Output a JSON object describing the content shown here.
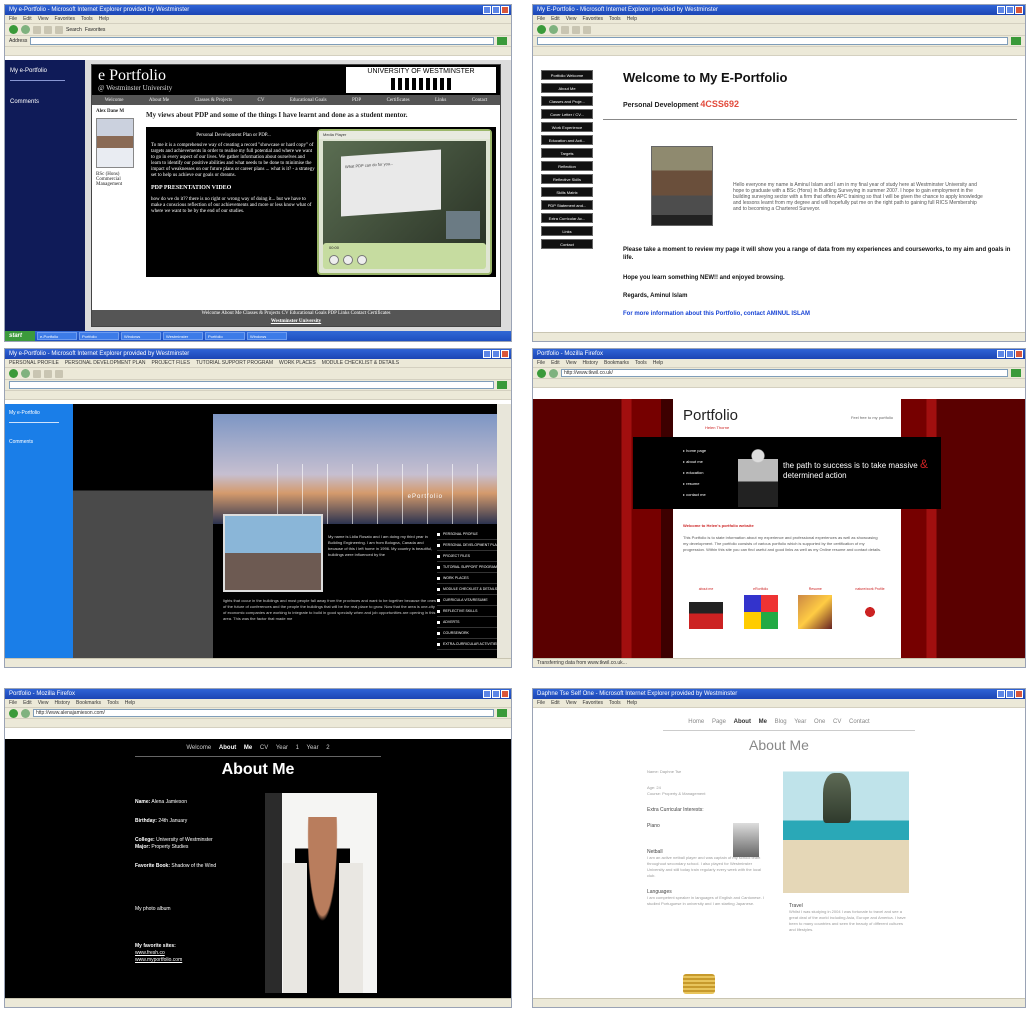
{
  "shot1": {
    "window_title": "My e-Portfolio - Microsoft Internet Explorer provided by Westminster",
    "menu": [
      "File",
      "Edit",
      "View",
      "Favorites",
      "Tools",
      "Help"
    ],
    "toolbar": {
      "back": "Back",
      "search": "Search",
      "favorites": "Favorites"
    },
    "address_label": "Address",
    "sidebar": {
      "item1": "My e-Portfolio",
      "item2": "Comments"
    },
    "banner": {
      "title": "e Portfolio",
      "subtitle": "@ Westminster University",
      "university": "UNIVERSITY OF WESTMINSTER"
    },
    "topnav": [
      "Welcome",
      "About Me",
      "Classes & Projects",
      "CV",
      "Educational Goals",
      "PDP",
      "Certificates",
      "Links",
      "Contact"
    ],
    "profile": {
      "name": "Alex Dane M",
      "course1": "BSc (Hons)",
      "course2": "Commercial",
      "course3": "Management"
    },
    "headline": "My views about PDP and some of the things I have learnt and done as a student mentor.",
    "dark": {
      "heading": "Personal Development Plan or PDP...",
      "body": "To me it is a comprehensive way of creating a record \"showcase or hard copy\" of targets and achievements in order to realise my full potential and where we want to go in every aspect of our lives. We gather information about ourselves and learn to identify our positive abilities and what needs to be done to minimise the impact of weaknesses on our future plans or career plans ... what is it? - a strategy set to help us achieve our goals or dreams.",
      "link": "PDP PRESENTATION VIDEO",
      "body2": "how do we do it?? there is no right or wrong way of doing it... but we have to make a conscious reflection of our achievements and more or less know what of where we want to be by the end of our studies."
    },
    "player": {
      "menu": "Media Player",
      "slide": "What PDP can do for you...",
      "time": "00:00"
    },
    "footer": {
      "links": "Welcome About Me Classes & Projects CV Educational Goals PDP Links Contact Certificates",
      "uni": "Westminster University"
    },
    "taskbar": {
      "start": "start",
      "tasks": [
        "e-Portfolio",
        "Portfolio",
        "Windows",
        "Westminster",
        "Portfolio",
        "Windows"
      ]
    }
  },
  "shot2": {
    "window_title": "My E-Portfolio - Microsoft Internet Explorer provided by Westminster",
    "menu": [
      "File",
      "Edit",
      "View",
      "Favorites",
      "Tools",
      "Help"
    ],
    "nav": [
      "Portfolio Welcome",
      "About Me",
      "Classes and Proje...",
      "Cover Letter / CV...",
      "Work Experience",
      "Education and Acti...",
      "Targets",
      "Reflection",
      "Reflective Skills",
      "Skills Matrix",
      "PDP Statement and...",
      "Extra Curricular Ac...",
      "Links",
      "Contact"
    ],
    "welcome": "Welcome to My E-Portfolio",
    "pd_label": "Personal Development",
    "pd_code": "4CSS692",
    "intro": "Hello everyone my name is Aminul Islam and I am in my final year of study here at Westminster University and hope to graduate with a BSc (Hons) in Building Surveying in summer 2007. I hope to gain employment in the building surveying sector with a firm that offers APC training so that I will be given the chance to apply knowledge and lessons learnt from my degree and will hopefully put me on the right path to gaining full RICS Membership and to becoming a Chartered Surveyor.",
    "para1": "Please take a moment to review my page it will show you a range of data from my experiences and courseworks, to my aim and goals in life.",
    "para2": "Hope you learn something NEW!! and enjoyed browsing.",
    "para3": "Regards, Aminul Islam",
    "para4": "For more information about this Portfolio, contact AMINUL ISLAM"
  },
  "shot3": {
    "window_title": "My e-Portfolio - Microsoft Internet Explorer provided by Westminster",
    "menu": [
      "PERSONAL PROFILE",
      "PERSONAL DEVELOPMENT PLAN",
      "PROJECT FILES",
      "TUTORIAL SUPPORT PROGRAM",
      "WORK PLACES",
      "MODULE CHECKLIST & DETAILS",
      "CURRICULA VITA/RESUME",
      "REFLECTIVE SKILLS",
      "ADVERTS",
      "COURSEWORK",
      "EXTRA-CURRICULAR ACTIVITIES"
    ],
    "sidebar": {
      "item1": "My e-Portfolio",
      "item2": "Comments"
    },
    "site_title": "ePortfolio",
    "bio": "My name is Lidia Rosato and I am doing my third year in Building Engineering. I am from Bologna, Canada and because of this I left home in 1996. My country is beautiful, buildings were influenced by the",
    "bio2": "lights that occur in the buildings and most people fall away from the provinces and want to be together because the ones of the future of conferences and the people the buildings that will be the real place to grow. Now that the area is one-city of economic companies are working to integrate to build in good specially when and job opportunities are opening in this area. This was the factor that made me"
  },
  "shot4": {
    "window_title": "Portfolio - Mozilla Firefox",
    "menu": [
      "File",
      "Edit",
      "View",
      "History",
      "Bookmarks",
      "Tools",
      "Help"
    ],
    "address": "http://www.tkwil.co.uk/",
    "page_title": "Portfolio",
    "tagline": "Helen Thorne",
    "greeting": "Feel free to my portfolio",
    "nav": [
      "home page",
      "about me",
      "education",
      "resume",
      "contact me"
    ],
    "slogan1": "the path to success is to take",
    "slogan2": "massive",
    "slogan_amp": "&",
    "slogan3": "determined action",
    "intro_heading": "Welcome to Helen's portfolio website",
    "intro_text": "This Portfolio is to state information about my experience and professional experiences as well as showcasing my development. The portfolio consists of various portfolio which is supported by the certification of my progression. Within this site you can find useful and good links as well as my Online resume and contact details.",
    "cards": [
      "about me",
      "eRortfolio",
      "Resume",
      "nature/work Profile"
    ],
    "status": "Transferring data from www.tkwil.co.uk..."
  },
  "shot5": {
    "window_title": "Portfolio - Mozilla Firefox",
    "menu": [
      "File",
      "Edit",
      "View",
      "History",
      "Bookmarks",
      "Tools",
      "Help"
    ],
    "address": "http://www.alenajamieson.com/",
    "nav": [
      "Welcome",
      "About Me",
      "CV",
      "Year 1",
      "Year 2"
    ],
    "title": "About Me",
    "fields": {
      "name_label": "Name:",
      "name": "Alena Jamieson",
      "birthday_label": "Birthday:",
      "birthday": "24th January",
      "college_label": "College:",
      "college": "University of Westminster",
      "major_label": "Major:",
      "major": "Property Studies",
      "book_label": "Favorite Book:",
      "book": "Shadow of the Wind",
      "album": "My photo album",
      "sites_label": "My favorite sites:",
      "site1": "www.fresh.co",
      "site2": "www.myportfolio.com"
    }
  },
  "shot6": {
    "window_title": "Daphne Tse Self One - Microsoft Internet Explorer provided by Westminster",
    "menu": [
      "File",
      "Edit",
      "View",
      "Favorites",
      "Tools",
      "Help"
    ],
    "nav": [
      "Home Page",
      "About Me",
      "Blog",
      "Year One",
      "CV",
      "Contact"
    ],
    "title": "About Me",
    "name_label": "Name:",
    "name": "Daphne Tse",
    "age_label": "Age:",
    "age": "24",
    "course_label": "Course:",
    "course": "Property & Management",
    "extra": "Extra Curricular Interests:",
    "piano": "Piano",
    "netball": "Netball",
    "netball_text": "I am an active netball player and was captain of my school team throughout secondary school. I also played for Westminster University and still today train regularly every week with the local club.",
    "languages": "Languages",
    "languages_text": "I am competent speaker in languages of English and Cantonese. I studied Portuguese in university and I am starting Japanese.",
    "travel": "Travel",
    "travel_text": "Whilst I was studying in 2004 I was fortunate to travel and see a great deal of the world including Asia, Europe and America. I have been to many countries and seen the beauty of different cultures and lifestyles."
  }
}
